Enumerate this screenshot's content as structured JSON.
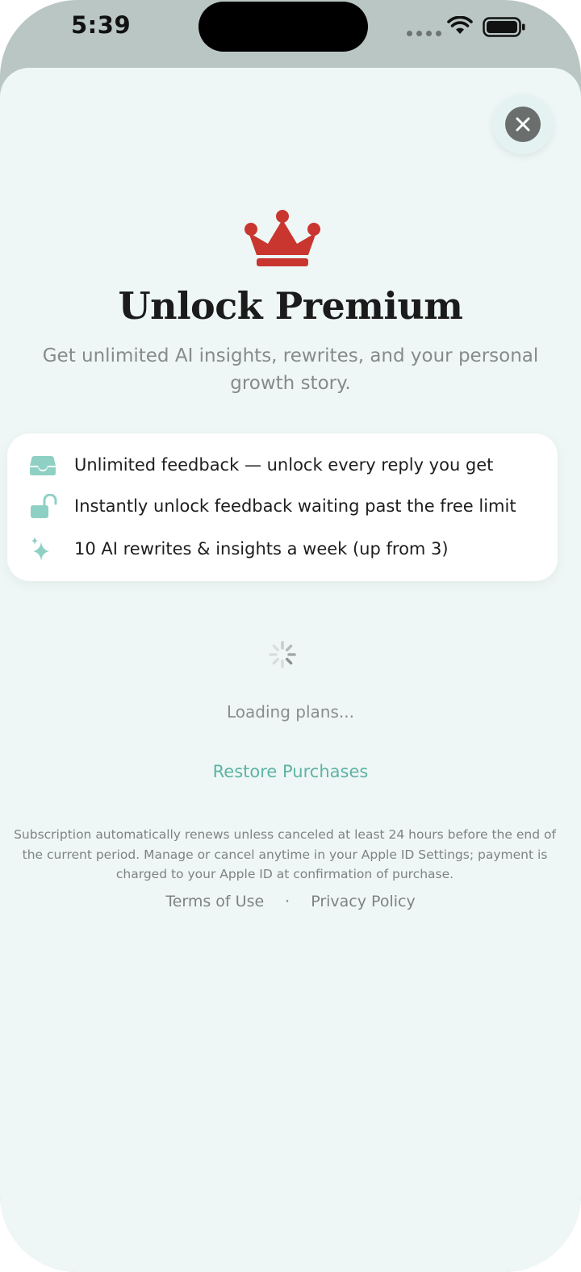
{
  "status_bar": {
    "time": "5:39",
    "icons": [
      "signal-dots-icon",
      "wifi-icon",
      "battery-icon"
    ]
  },
  "paywall": {
    "close_icon": "close-icon",
    "crown_icon": "crown-icon",
    "title": "Unlock Premium",
    "subtitle": "Get unlimited AI insights, rewrites, and your personal growth story.",
    "features": [
      {
        "icon": "inbox-icon",
        "text": "Unlimited feedback — unlock every reply you get"
      },
      {
        "icon": "unlock-icon",
        "text": "Instantly unlock feedback waiting past the free limit"
      },
      {
        "icon": "sparkles-icon",
        "text": "10 AI rewrites & insights a week (up from 3)"
      }
    ],
    "loading_text": "Loading plans...",
    "restore_label": "Restore Purchases",
    "legal_text": "Subscription automatically renews unless canceled at least 24 hours before the end of the current period. Manage or cancel anytime in your Apple ID Settings; payment is charged to your Apple ID at confirmation of purchase.",
    "terms_label": "Terms of Use",
    "separator": "·",
    "privacy_label": "Privacy Policy"
  },
  "colors": {
    "accent": "#5fb3a4",
    "crown": "#c9362f",
    "sheet_background": "#eef7f6",
    "icon_tint": "#8fd0c4"
  }
}
